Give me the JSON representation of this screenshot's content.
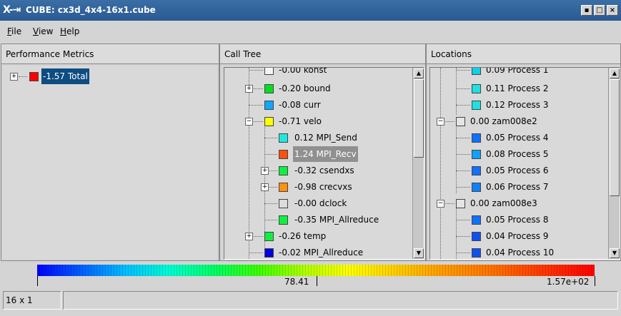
{
  "window": {
    "title": "CUBE:  cx3d_4x4-16x1.cube",
    "logo_glyph": "X-⇥"
  },
  "menu": [
    {
      "label": "File",
      "u": "F"
    },
    {
      "label": "View",
      "u": "V"
    },
    {
      "label": "Help",
      "u": "H"
    }
  ],
  "panels": {
    "metrics": {
      "header": "Performance Metrics",
      "items": [
        {
          "expander": "+",
          "color": "#ff0000",
          "label": "-1.57 Total",
          "selected": true
        }
      ]
    },
    "calltree": {
      "header": "Call Tree",
      "items": [
        {
          "expander": "",
          "color": "#f4f4f4",
          "label": "-0.00 konst",
          "indent": 1
        },
        {
          "expander": "+",
          "color": "#00e020",
          "label": "-0.20 bound",
          "indent": 1
        },
        {
          "expander": "",
          "color": "#10a8ff",
          "label": "-0.08 curr",
          "indent": 1
        },
        {
          "expander": "−",
          "color": "#ffff00",
          "label": "-0.71 velo",
          "indent": 1
        },
        {
          "expander": "",
          "color": "#20e8e0",
          "label": "0.12 MPI_Send",
          "indent": 2
        },
        {
          "expander": "",
          "color": "#ff5010",
          "label": "1.24 MPI_Recv",
          "indent": 2,
          "selected": true
        },
        {
          "expander": "+",
          "color": "#10f040",
          "label": "-0.32 csendxs",
          "indent": 2
        },
        {
          "expander": "+",
          "color": "#ff9010",
          "label": "-0.98 crecvxs",
          "indent": 2
        },
        {
          "expander": "",
          "color": "#dcdcdc",
          "label": "-0.00 dclock",
          "indent": 2
        },
        {
          "expander": "",
          "color": "#10f040",
          "label": "-0.35 MPI_Allreduce",
          "indent": 2
        },
        {
          "expander": "+",
          "color": "#10f040",
          "label": "-0.26 temp",
          "indent": 1
        },
        {
          "expander": "",
          "color": "#0000e0",
          "label": "-0.02 MPI_Allreduce",
          "indent": 1
        }
      ]
    },
    "locations": {
      "header": "Locations",
      "items": [
        {
          "expander": "",
          "color": "#10d0e8",
          "label": "0.09 Process 1",
          "indent": 2
        },
        {
          "expander": "",
          "color": "#20e0e0",
          "label": "0.11 Process 2",
          "indent": 2
        },
        {
          "expander": "",
          "color": "#20e0e0",
          "label": "0.12 Process 3",
          "indent": 2
        },
        {
          "expander": "−",
          "color": "#e4e4e4",
          "label": "0.00 zam008e2",
          "indent": 1
        },
        {
          "expander": "",
          "color": "#1070ff",
          "label": "0.05 Process 4",
          "indent": 2
        },
        {
          "expander": "",
          "color": "#10a0ff",
          "label": "0.08 Process 5",
          "indent": 2
        },
        {
          "expander": "",
          "color": "#1070ff",
          "label": "0.05 Process 6",
          "indent": 2
        },
        {
          "expander": "",
          "color": "#1080ff",
          "label": "0.06 Process 7",
          "indent": 2
        },
        {
          "expander": "−",
          "color": "#e4e4e4",
          "label": "0.00 zam008e3",
          "indent": 1
        },
        {
          "expander": "",
          "color": "#1070ff",
          "label": "0.05 Process 8",
          "indent": 2
        },
        {
          "expander": "",
          "color": "#1050f0",
          "label": "0.04 Process 9",
          "indent": 2
        },
        {
          "expander": "",
          "color": "#1050f0",
          "label": "0.04 Process 10",
          "indent": 2
        }
      ]
    }
  },
  "colorbar": {
    "mid_label": "78.41",
    "max_label": "1.57e+02"
  },
  "status": {
    "topology": "16 x 1"
  }
}
